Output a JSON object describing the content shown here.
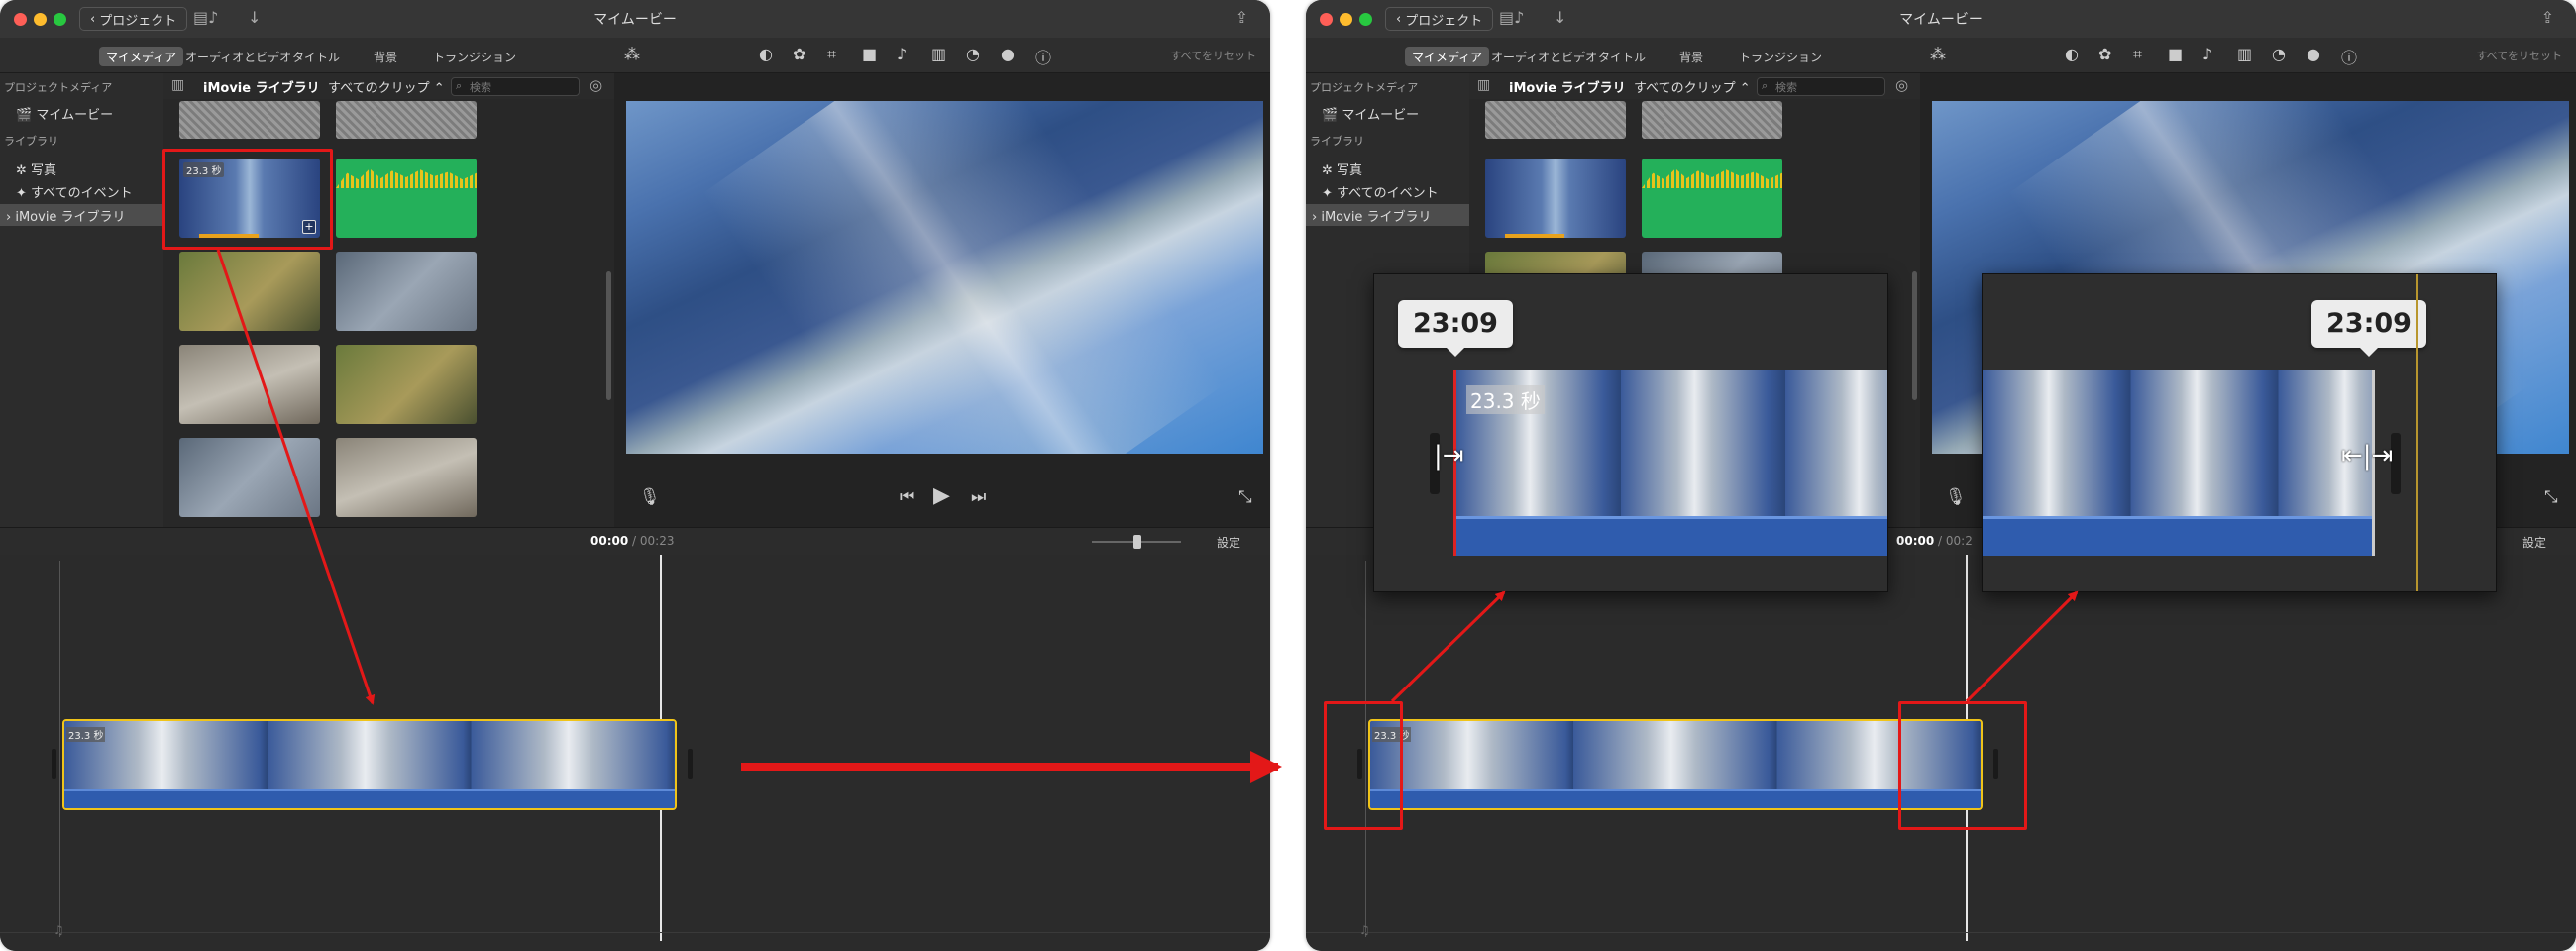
{
  "windows": [
    {
      "back_label": "プロジェクト",
      "title": "マイムービー",
      "tabs": [
        "マイメディア",
        "オーディオとビデオ",
        "タイトル",
        "背景",
        "トランジション"
      ],
      "reset_label": "すべてをリセット",
      "sidebar": {
        "project_media_heading": "プロジェクトメディア",
        "my_movie": "マイムービー",
        "library_heading": "ライブラリ",
        "photos": "写真",
        "all_events": "すべてのイベント",
        "imovie_library": "iMovie ライブラリ"
      },
      "browser": {
        "library_name": "iMovie ライブラリ",
        "clips_filter": "すべてのクリップ",
        "search_placeholder": "検索",
        "clip_duration_badge": "23.3 秒"
      },
      "timecode": {
        "current": "00:00",
        "separator": "/",
        "total": "00:23"
      },
      "settings_label": "設定",
      "clip_badge": "23.3 秒"
    },
    {
      "back_label": "プロジェクト",
      "title": "マイムービー",
      "tabs": [
        "マイメディア",
        "オーディオとビデオ",
        "タイトル",
        "背景",
        "トランジション"
      ],
      "reset_label": "すべてをリセット",
      "sidebar": {
        "project_media_heading": "プロジェクトメディア",
        "my_movie": "マイムービー",
        "library_heading": "ライブラリ",
        "photos": "写真",
        "all_events": "すべてのイベント",
        "imovie_library": "iMovie ライブラリ"
      },
      "browser": {
        "library_name": "iMovie ライブラリ",
        "clips_filter": "すべてのクリップ",
        "search_placeholder": "検索"
      },
      "timecode": {
        "current": "00:00",
        "separator": "/",
        "total": "00:2"
      },
      "settings_label": "設定",
      "clip_badge": "23.3 秒"
    }
  ],
  "callouts": {
    "left_tooltip": "23:09",
    "right_tooltip": "23:09",
    "left_badge": "23.3 秒"
  },
  "colors": {
    "highlight_red": "#e31818",
    "clip_border_yellow": "#f0c419",
    "audio_blue": "#2f5cae"
  }
}
